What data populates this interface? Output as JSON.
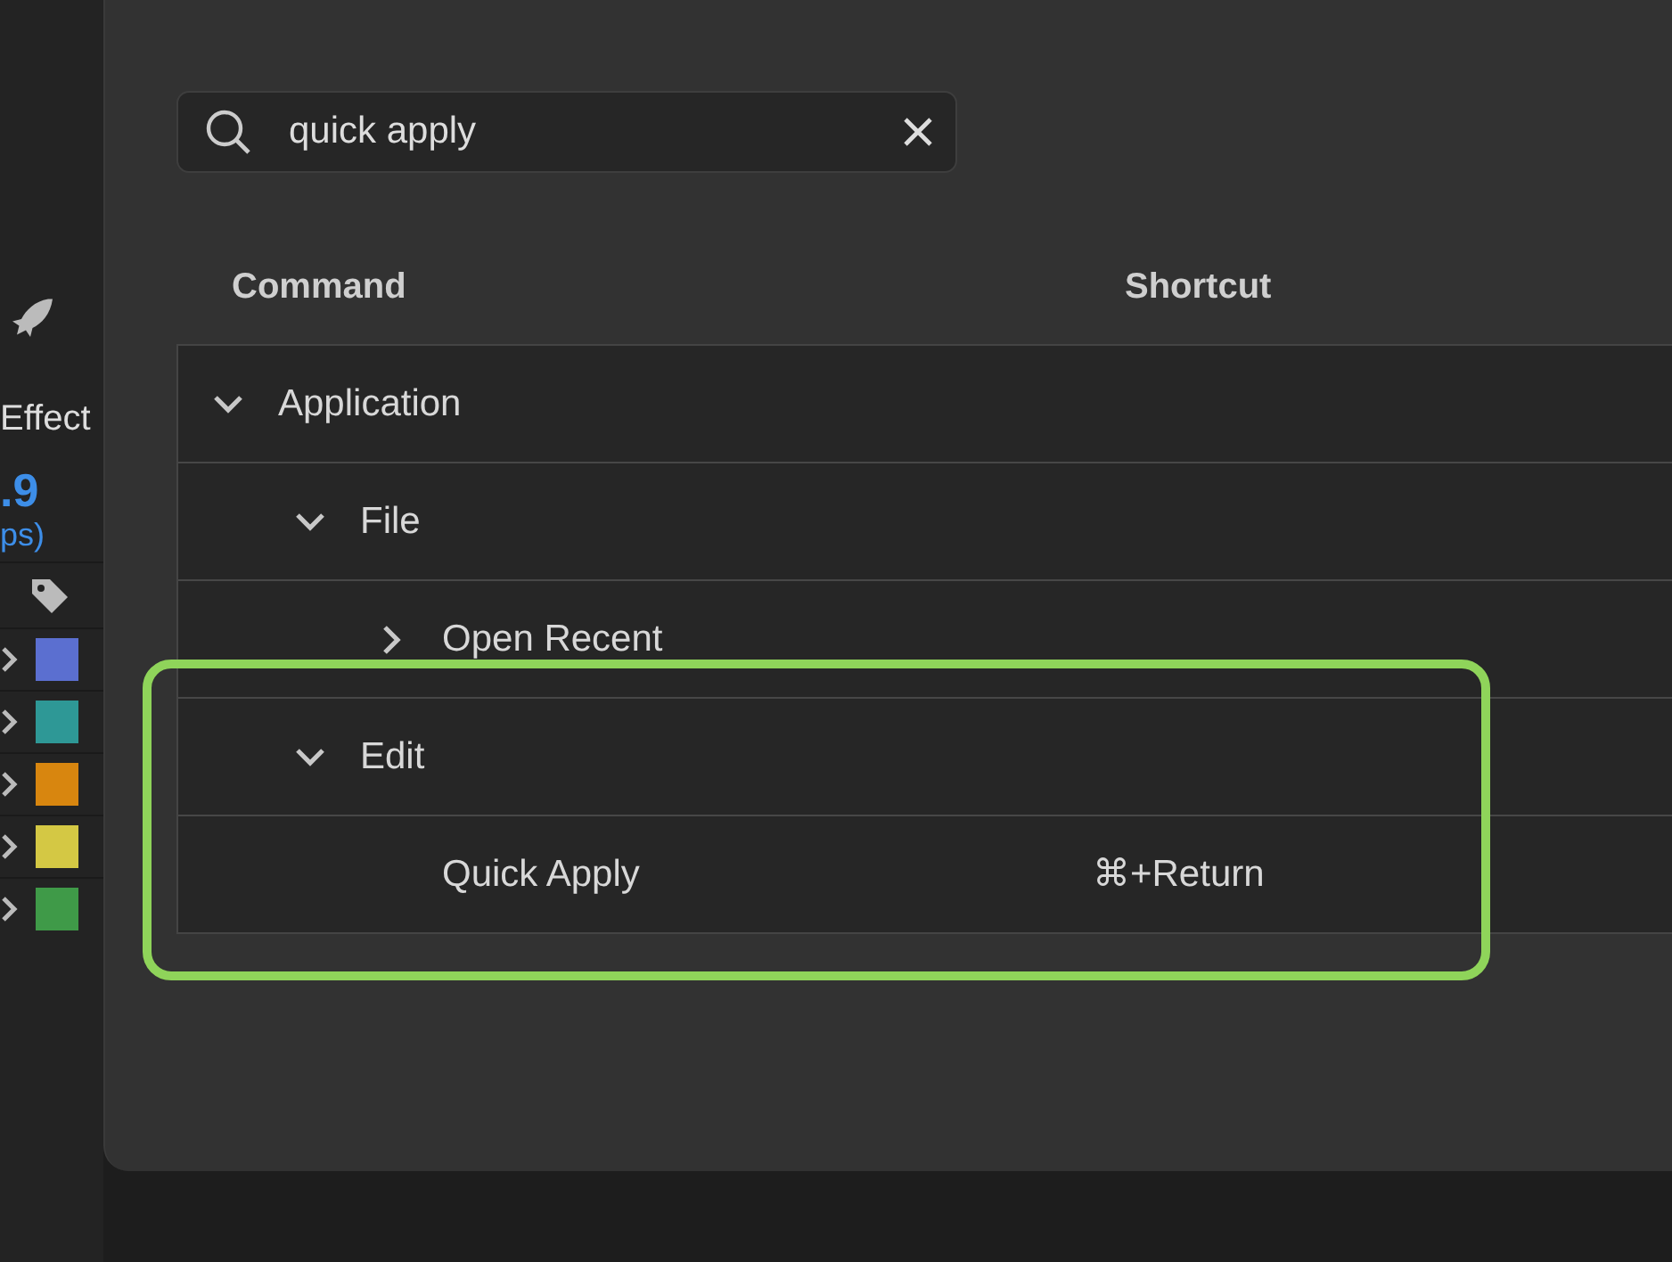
{
  "left_panel": {
    "panel_title": "Effect",
    "frame_rate": ".9",
    "frame_rate_unit": "ps)",
    "layers": [
      {
        "color": "#5b6fd0"
      },
      {
        "color": "#2e9896"
      },
      {
        "color": "#d8860f"
      },
      {
        "color": "#d4c844"
      },
      {
        "color": "#3f9a48"
      }
    ]
  },
  "search": {
    "value": "quick apply"
  },
  "columns": [
    "Command",
    "Shortcut"
  ],
  "commands": [
    {
      "label": "Application",
      "expanded": true,
      "children": [
        {
          "label": "File",
          "expanded": true,
          "children": [
            {
              "label": "Open Recent",
              "expanded": false
            }
          ]
        },
        {
          "label": "Edit",
          "expanded": true,
          "children": [
            {
              "label": "Quick Apply",
              "shortcut": "⌘+Return"
            }
          ]
        }
      ]
    }
  ]
}
